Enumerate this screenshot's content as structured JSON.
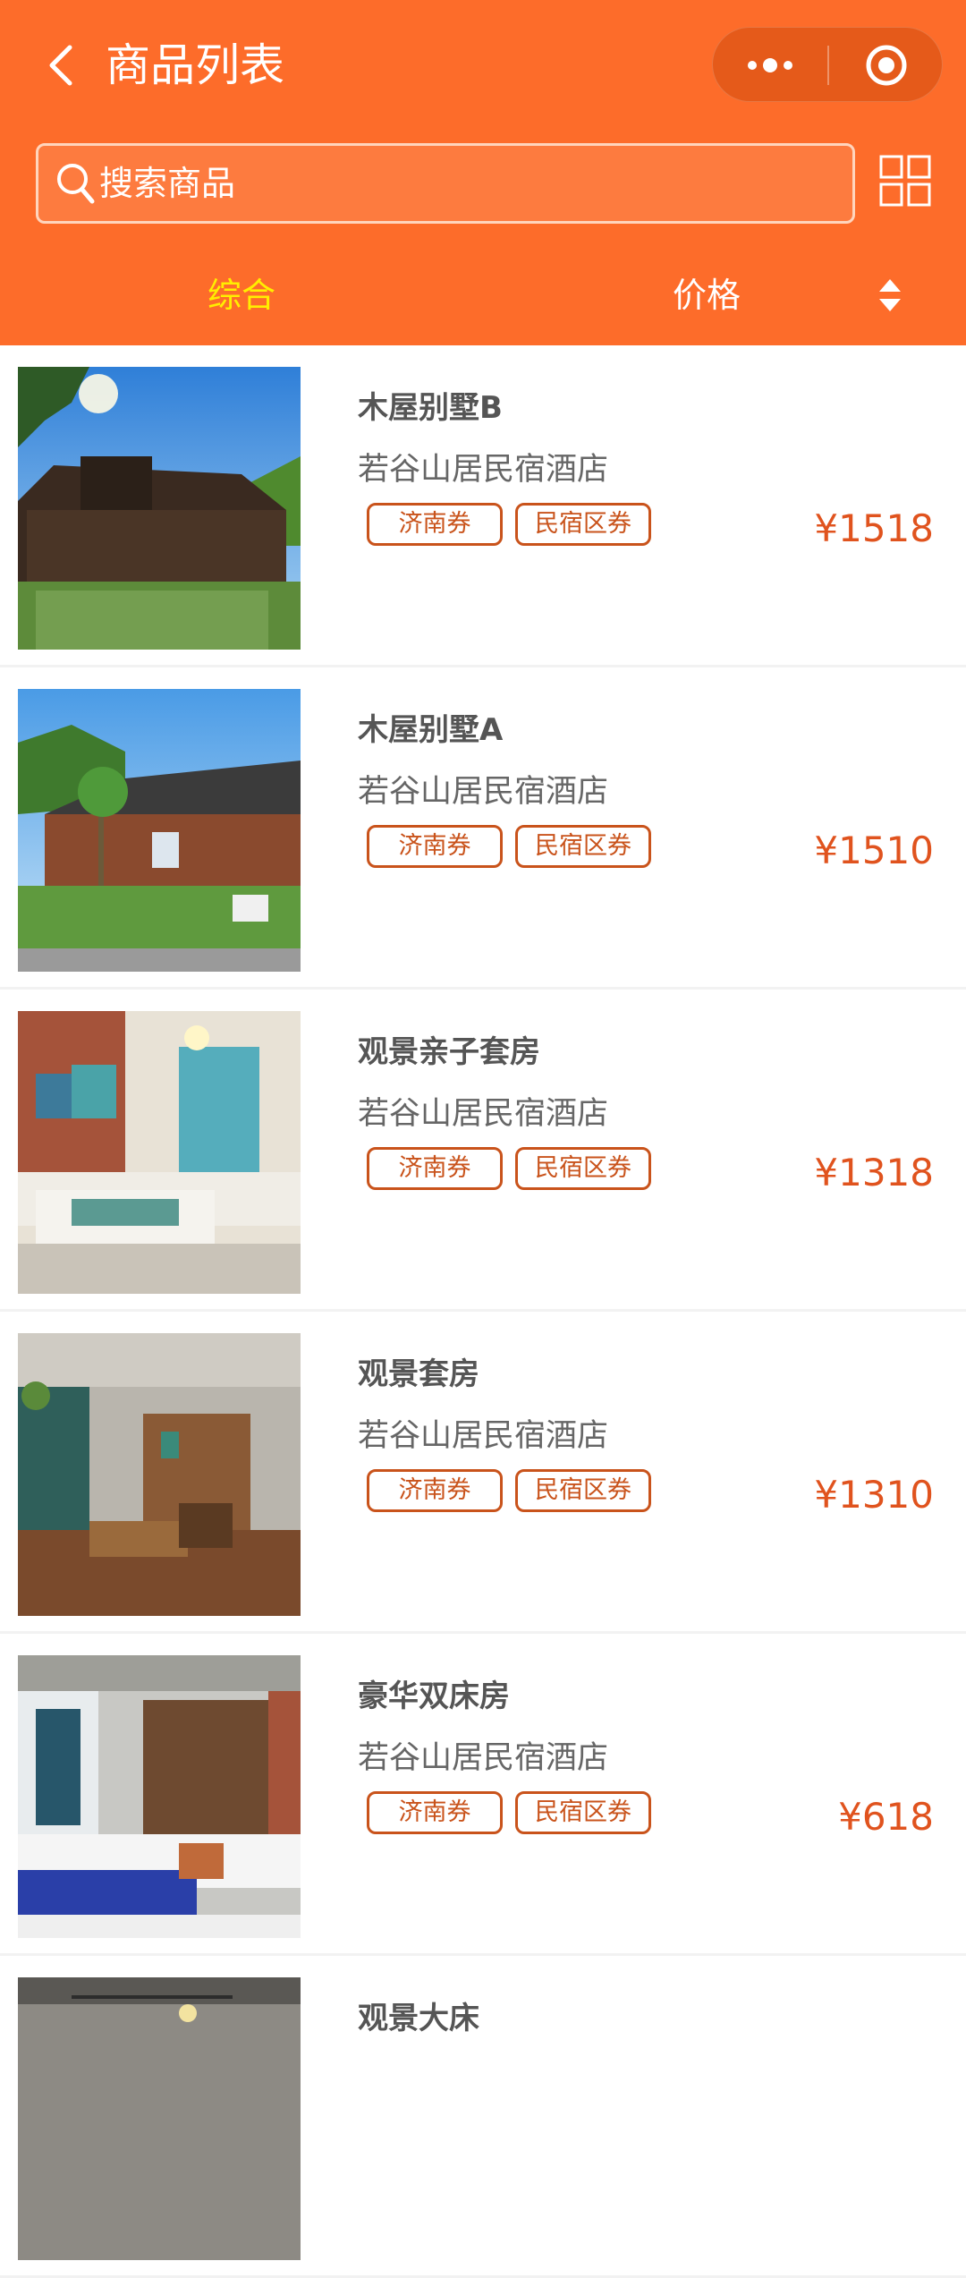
{
  "header": {
    "title": "商品列表",
    "back_icon": "chevron-left-icon",
    "more_icon": "more-dots-icon",
    "close_icon": "target-circle-icon",
    "bg_color": "#fd6c2a"
  },
  "search": {
    "placeholder": "搜索商品",
    "icon": "search-icon"
  },
  "view_toggle_icon": "grid-view-icon",
  "sort": {
    "tabs": [
      {
        "label": "综合",
        "active": true,
        "color": "#ffee00"
      },
      {
        "label": "价格",
        "active": false,
        "color": "#ffffff"
      }
    ],
    "sort_icon": "sort-updown-icon"
  },
  "products": [
    {
      "name": "木屋别墅B",
      "hotel": "若谷山居民宿酒店",
      "tags": [
        "济南券",
        "民宿区券"
      ],
      "price": "¥1518"
    },
    {
      "name": "木屋别墅A",
      "hotel": "若谷山居民宿酒店",
      "tags": [
        "济南券",
        "民宿区券"
      ],
      "price": "¥1510"
    },
    {
      "name": "观景亲子套房",
      "hotel": "若谷山居民宿酒店",
      "tags": [
        "济南券",
        "民宿区券"
      ],
      "price": "¥1318"
    },
    {
      "name": "观景套房",
      "hotel": "若谷山居民宿酒店",
      "tags": [
        "济南券",
        "民宿区券"
      ],
      "price": "¥1310"
    },
    {
      "name": "豪华双床房",
      "hotel": "若谷山居民宿酒店",
      "tags": [
        "济南券",
        "民宿区券"
      ],
      "price": "¥618"
    },
    {
      "name": "观景大床",
      "hotel": "",
      "tags": [],
      "price": ""
    }
  ],
  "colors": {
    "accent": "#fd6c2a",
    "price": "#e0531e",
    "tag_border": "#c9531b"
  }
}
